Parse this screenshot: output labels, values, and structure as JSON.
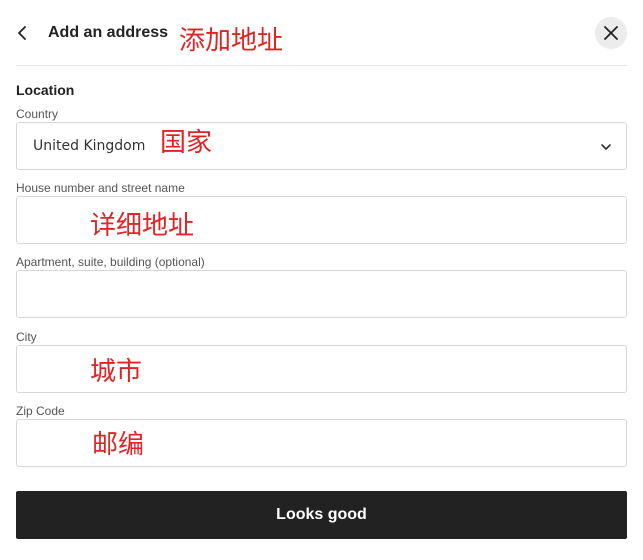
{
  "header": {
    "title": "Add an address",
    "annotation": "添加地址"
  },
  "form": {
    "section_title": "Location",
    "country": {
      "label": "Country",
      "value": "United Kingdom",
      "annotation": "国家"
    },
    "street": {
      "label": "House number and street name",
      "value": "",
      "annotation": "详细地址"
    },
    "apartment": {
      "label": "Apartment, suite, building (optional)",
      "value": ""
    },
    "city": {
      "label": "City",
      "value": "",
      "annotation": "城市"
    },
    "zip": {
      "label": "Zip Code",
      "value": "",
      "annotation": "邮编"
    }
  },
  "submit_label": "Looks good",
  "icons": {
    "back": "chevron-left-icon",
    "close": "close-icon",
    "dropdown": "chevron-down-icon"
  },
  "colors": {
    "annotation": "#e02424",
    "primary_button": "#222222"
  }
}
